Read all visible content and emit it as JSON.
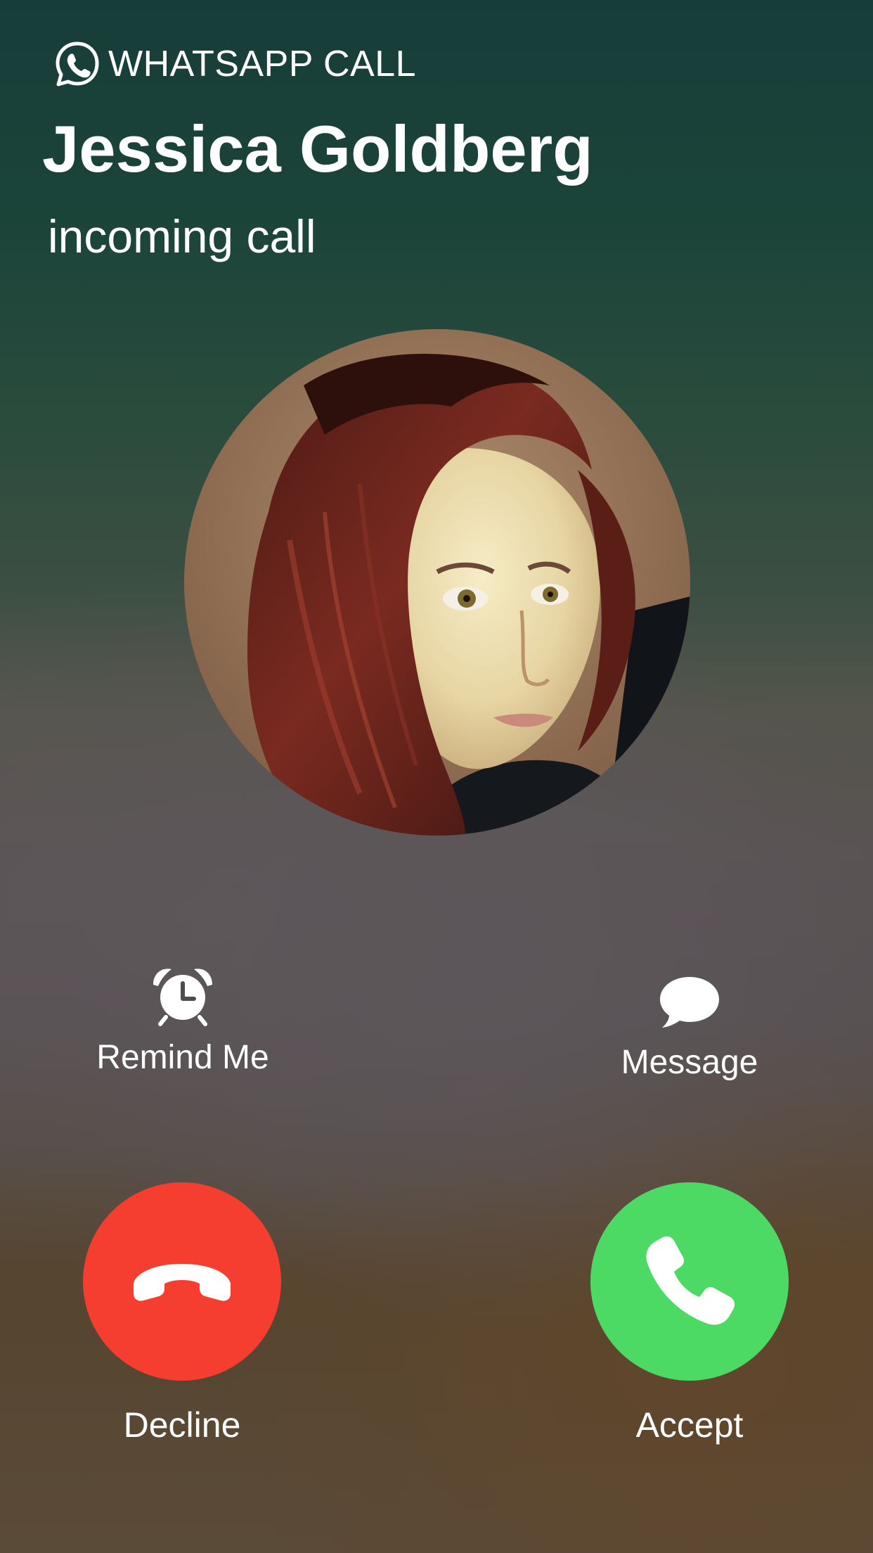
{
  "header": {
    "app_label": "WHATSAPP CALL",
    "app_icon": "whatsapp-icon"
  },
  "caller": {
    "name": "Jessica Goldberg",
    "status": "incoming call",
    "avatar": "caller-photo"
  },
  "secondary_actions": {
    "remind": {
      "label": "Remind Me",
      "icon": "alarm-clock-icon"
    },
    "message": {
      "label": "Message",
      "icon": "speech-bubble-icon"
    }
  },
  "primary_actions": {
    "decline": {
      "label": "Decline",
      "icon": "hang-up-icon",
      "color": "#f53d30"
    },
    "accept": {
      "label": "Accept",
      "icon": "phone-icon",
      "color": "#4cd964"
    }
  }
}
